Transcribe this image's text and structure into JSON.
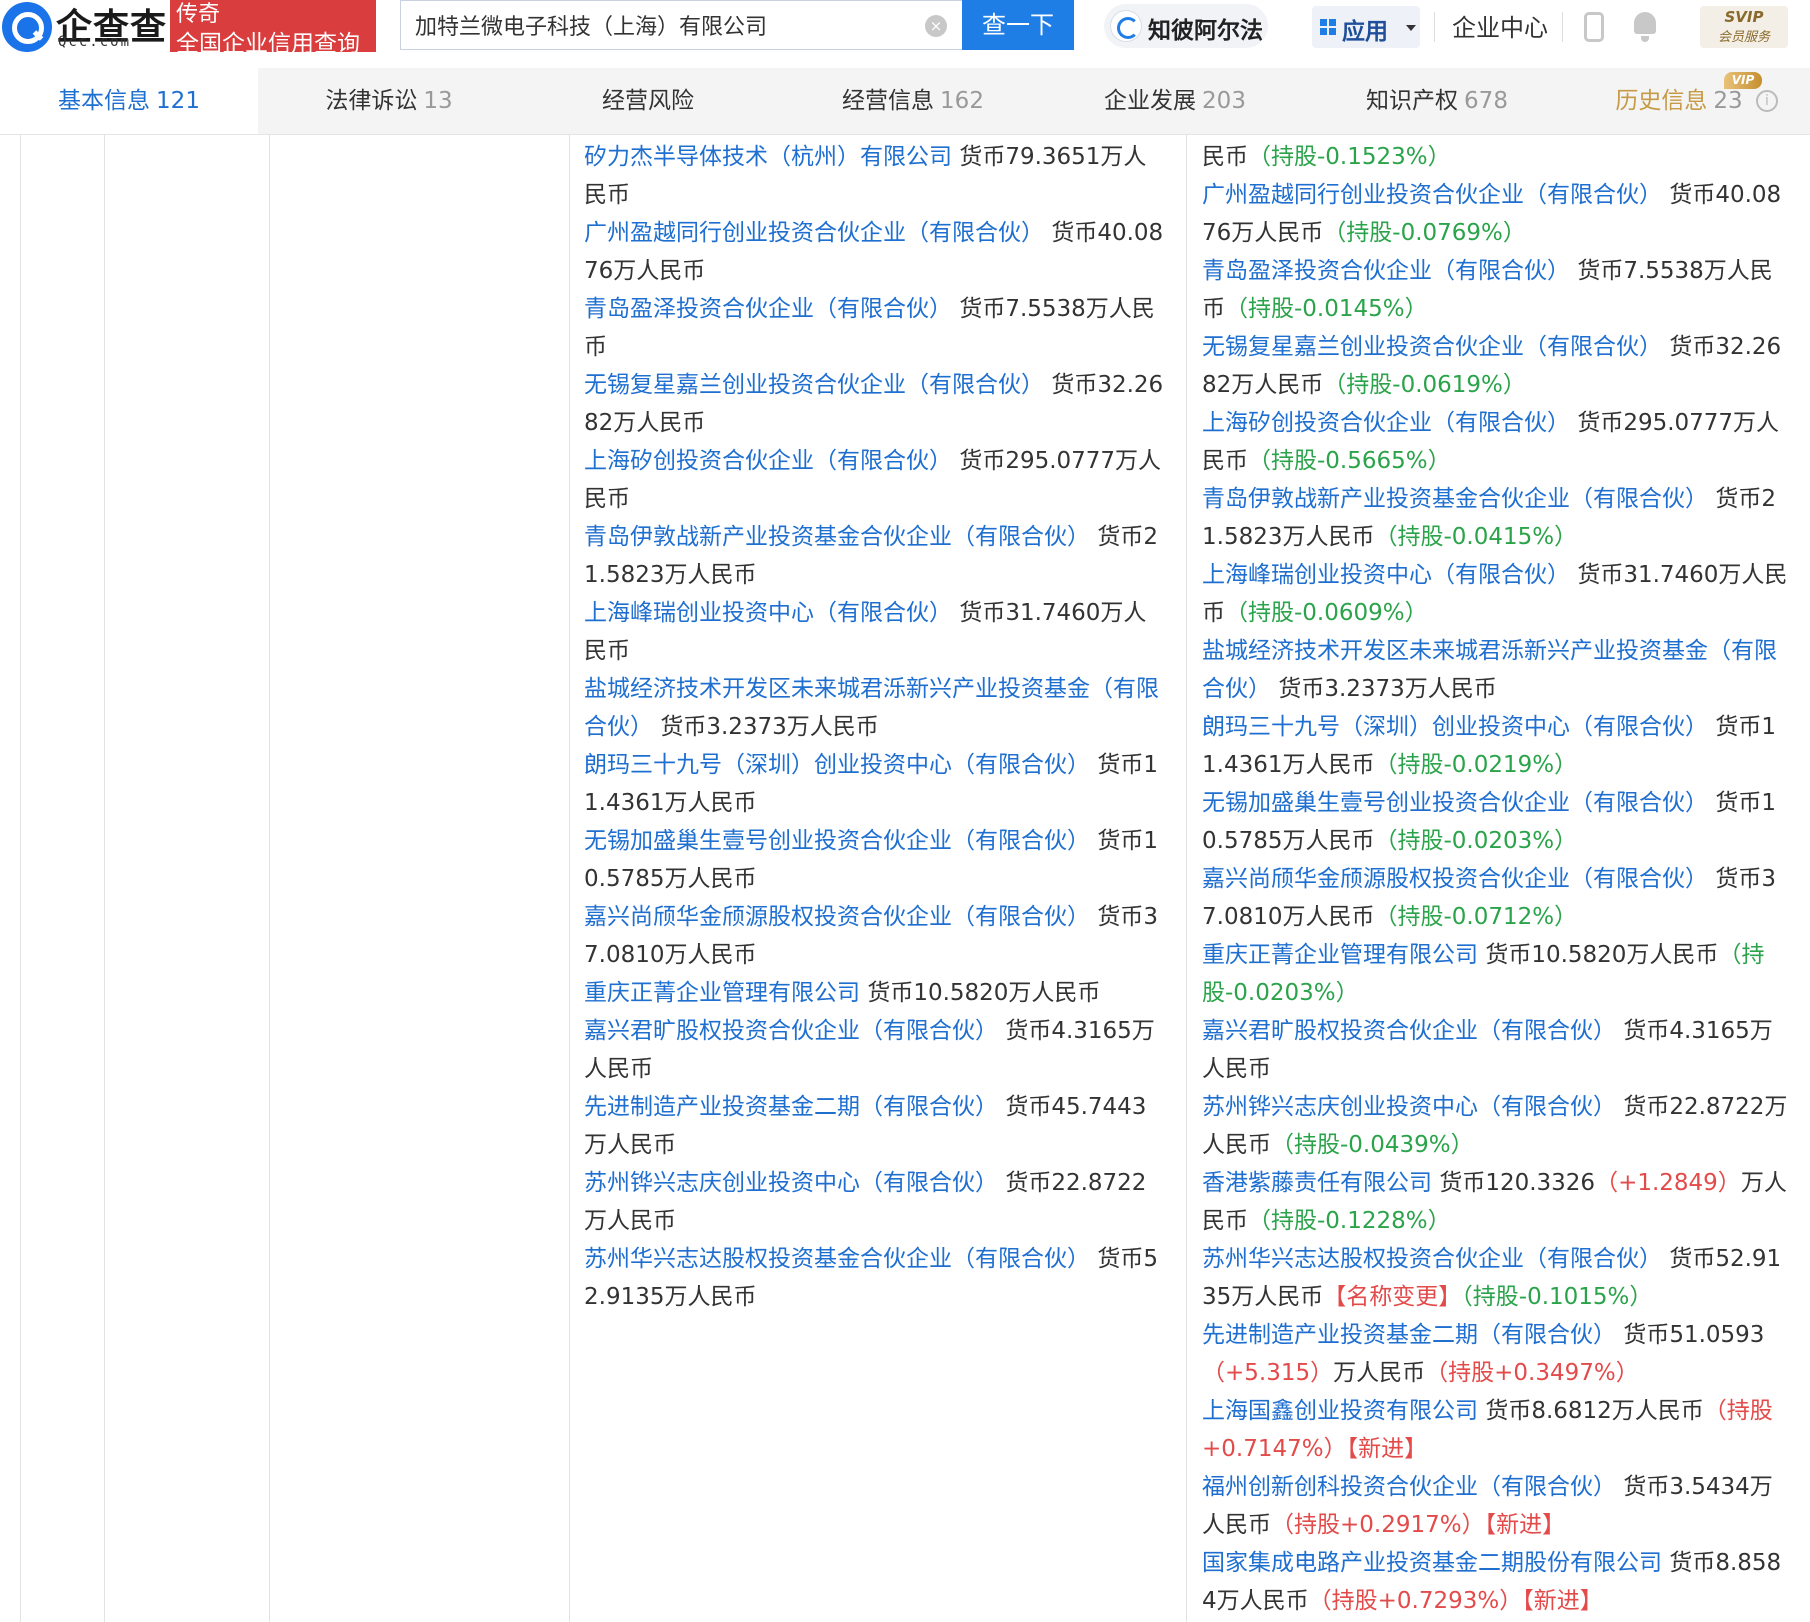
{
  "header": {
    "brand": "企查查",
    "brand_sub": "Qcc.com",
    "slogan_line1": "传奇",
    "slogan_line2": "全国企业信用查询",
    "search_value": "加特兰微电子科技（上海）有限公司",
    "search_button": "查一下",
    "clear_symbol": "×",
    "zhibi_label": "知彼阿尔法",
    "apps_label": "应用",
    "enterprise_center": "企业中心",
    "svip_line1": "SVIP",
    "svip_line2": "会员服务"
  },
  "tabs": [
    {
      "label": "基本信息",
      "count": "121"
    },
    {
      "label": "法律诉讼",
      "count": "13"
    },
    {
      "label": "经营风险",
      "count": ""
    },
    {
      "label": "经营信息",
      "count": "162"
    },
    {
      "label": "企业发展",
      "count": "203"
    },
    {
      "label": "知识产权",
      "count": "678"
    },
    {
      "label": "历史信息",
      "count": "23"
    }
  ],
  "vip_badge": "VIP",
  "info_symbol": "i",
  "left_entries": [
    {
      "name": "矽力杰半导体技术（杭州）有限公司",
      "amount": "货币79.3651万人民币"
    },
    {
      "name": "广州盈越同行创业投资合伙企业（有限合伙）",
      "amount": "货币40.0876万人民币"
    },
    {
      "name": "青岛盈泽投资合伙企业（有限合伙）",
      "amount": "货币7.5538万人民币"
    },
    {
      "name": "无锡复星嘉兰创业投资合伙企业（有限合伙）",
      "amount": "货币32.2682万人民币"
    },
    {
      "name": "上海矽创投资合伙企业（有限合伙）",
      "amount": "货币295.0777万人民币"
    },
    {
      "name": "青岛伊敦战新产业投资基金合伙企业（有限合伙）",
      "amount": "货币21.5823万人民币"
    },
    {
      "name": "上海峰瑞创业投资中心（有限合伙）",
      "amount": "货币31.7460万人民币"
    },
    {
      "name": "盐城经济技术开发区未来城君泺新兴产业投资基金（有限合伙）",
      "amount": "货币3.2373万人民币"
    },
    {
      "name": "朗玛三十九号（深圳）创业投资中心（有限合伙）",
      "amount": "货币11.4361万人民币"
    },
    {
      "name": "无锡加盛巢生壹号创业投资合伙企业（有限合伙）",
      "amount": "货币10.5785万人民币"
    },
    {
      "name": "嘉兴尚颀华金颀源股权投资合伙企业（有限合伙）",
      "amount": "货币37.0810万人民币"
    },
    {
      "name": "重庆正菁企业管理有限公司",
      "amount": "货币10.5820万人民币"
    },
    {
      "name": "嘉兴君旷股权投资合伙企业（有限合伙）",
      "amount": "货币4.3165万人民币"
    },
    {
      "name": "先进制造产业投资基金二期（有限合伙）",
      "amount": "货币45.7443万人民币"
    },
    {
      "name": "苏州铧兴志庆创业投资中心（有限合伙）",
      "amount": "货币22.8722万人民币"
    },
    {
      "name": "苏州华兴志达股权投资基金合伙企业（有限合伙）",
      "amount": "货币52.9135万人民币"
    }
  ],
  "right_entries": [
    {
      "name": "",
      "amount": "民币",
      "pct": "（持股-0.1523%）",
      "pct_dir": "down"
    },
    {
      "name": "广州盈越同行创业投资合伙企业（有限合伙）",
      "amount": "货币40.0876万人民币",
      "pct": "（持股-0.0769%）",
      "pct_dir": "down"
    },
    {
      "name": "青岛盈泽投资合伙企业（有限合伙）",
      "amount": "货币7.5538万人民币",
      "pct": "（持股-0.0145%）",
      "pct_dir": "down"
    },
    {
      "name": "无锡复星嘉兰创业投资合伙企业（有限合伙）",
      "amount": "货币32.2682万人民币",
      "pct": "（持股-0.0619%）",
      "pct_dir": "down"
    },
    {
      "name": "上海矽创投资合伙企业（有限合伙）",
      "amount": "货币295.0777万人民币",
      "pct": "（持股-0.5665%）",
      "pct_dir": "down"
    },
    {
      "name": "青岛伊敦战新产业投资基金合伙企业（有限合伙）",
      "amount": "货币21.5823万人民币",
      "pct": "（持股-0.0415%）",
      "pct_dir": "down"
    },
    {
      "name": "上海峰瑞创业投资中心（有限合伙）",
      "amount": "货币31.7460万人民币",
      "pct": "（持股-0.0609%）",
      "pct_dir": "down"
    },
    {
      "name": "盐城经济技术开发区未来城君泺新兴产业投资基金（有限合伙）",
      "amount": "货币3.2373万人民币",
      "pct": "",
      "pct_dir": ""
    },
    {
      "name": "朗玛三十九号（深圳）创业投资中心（有限合伙）",
      "amount": "货币11.4361万人民币",
      "pct": "（持股-0.0219%）",
      "pct_dir": "down"
    },
    {
      "name": "无锡加盛巢生壹号创业投资合伙企业（有限合伙）",
      "amount": "货币10.5785万人民币",
      "pct": "（持股-0.0203%）",
      "pct_dir": "down"
    },
    {
      "name": "嘉兴尚颀华金颀源股权投资合伙企业（有限合伙）",
      "amount": "货币37.0810万人民币",
      "pct": "（持股-0.0712%）",
      "pct_dir": "down"
    },
    {
      "name": "重庆正菁企业管理有限公司",
      "amount": "货币10.5820万人民币",
      "pct": "（持股-0.0203%）",
      "pct_dir": "down"
    },
    {
      "name": "嘉兴君旷股权投资合伙企业（有限合伙）",
      "amount": "货币4.3165万人民币",
      "pct": "",
      "pct_dir": ""
    },
    {
      "name": "苏州铧兴志庆创业投资中心（有限合伙）",
      "amount": "货币22.8722万人民币",
      "pct": "（持股-0.0439%）",
      "pct_dir": "down"
    },
    {
      "name": "香港紫藤责任有限公司",
      "amount": "货币120.3326",
      "change": "（+1.2849）",
      "amount_tail": "万人民币",
      "pct": "（持股-0.1228%）",
      "pct_dir": "down"
    },
    {
      "name": "苏州华兴志达股权投资合伙企业（有限合伙）",
      "amount": "货币52.9135万人民币",
      "tag": "【名称变更】",
      "pct": "（持股-0.1015%）",
      "pct_dir": "down"
    },
    {
      "name": "先进制造产业投资基金二期（有限合伙）",
      "amount": "货币51.0593",
      "change": "（+5.315）",
      "amount_tail": "万人民币",
      "pct": "（持股+0.3497%）",
      "pct_dir": "up"
    },
    {
      "name": "上海国鑫创业投资有限公司",
      "amount": "货币8.6812万人民币",
      "pct": "（持股+0.7147%）",
      "pct_dir": "up",
      "tag_after": "【新进】"
    },
    {
      "name": "福州创新创科投资合伙企业（有限合伙）",
      "amount": "货币3.5434万人民币",
      "pct": "（持股+0.2917%）",
      "pct_dir": "up",
      "tag_after": "【新进】"
    },
    {
      "name": "国家集成电路产业投资基金二期股份有限公司",
      "amount": "货币8.8584万人民币",
      "pct": "（持股+0.7293%）",
      "pct_dir": "up",
      "tag_after": "【新进】"
    }
  ],
  "colors": {
    "link": "#1f6fd1",
    "decrease": "#2aa34a",
    "increase": "#e34a4a",
    "brand_red": "#d93d3d",
    "search_blue": "#1f7ee6"
  }
}
